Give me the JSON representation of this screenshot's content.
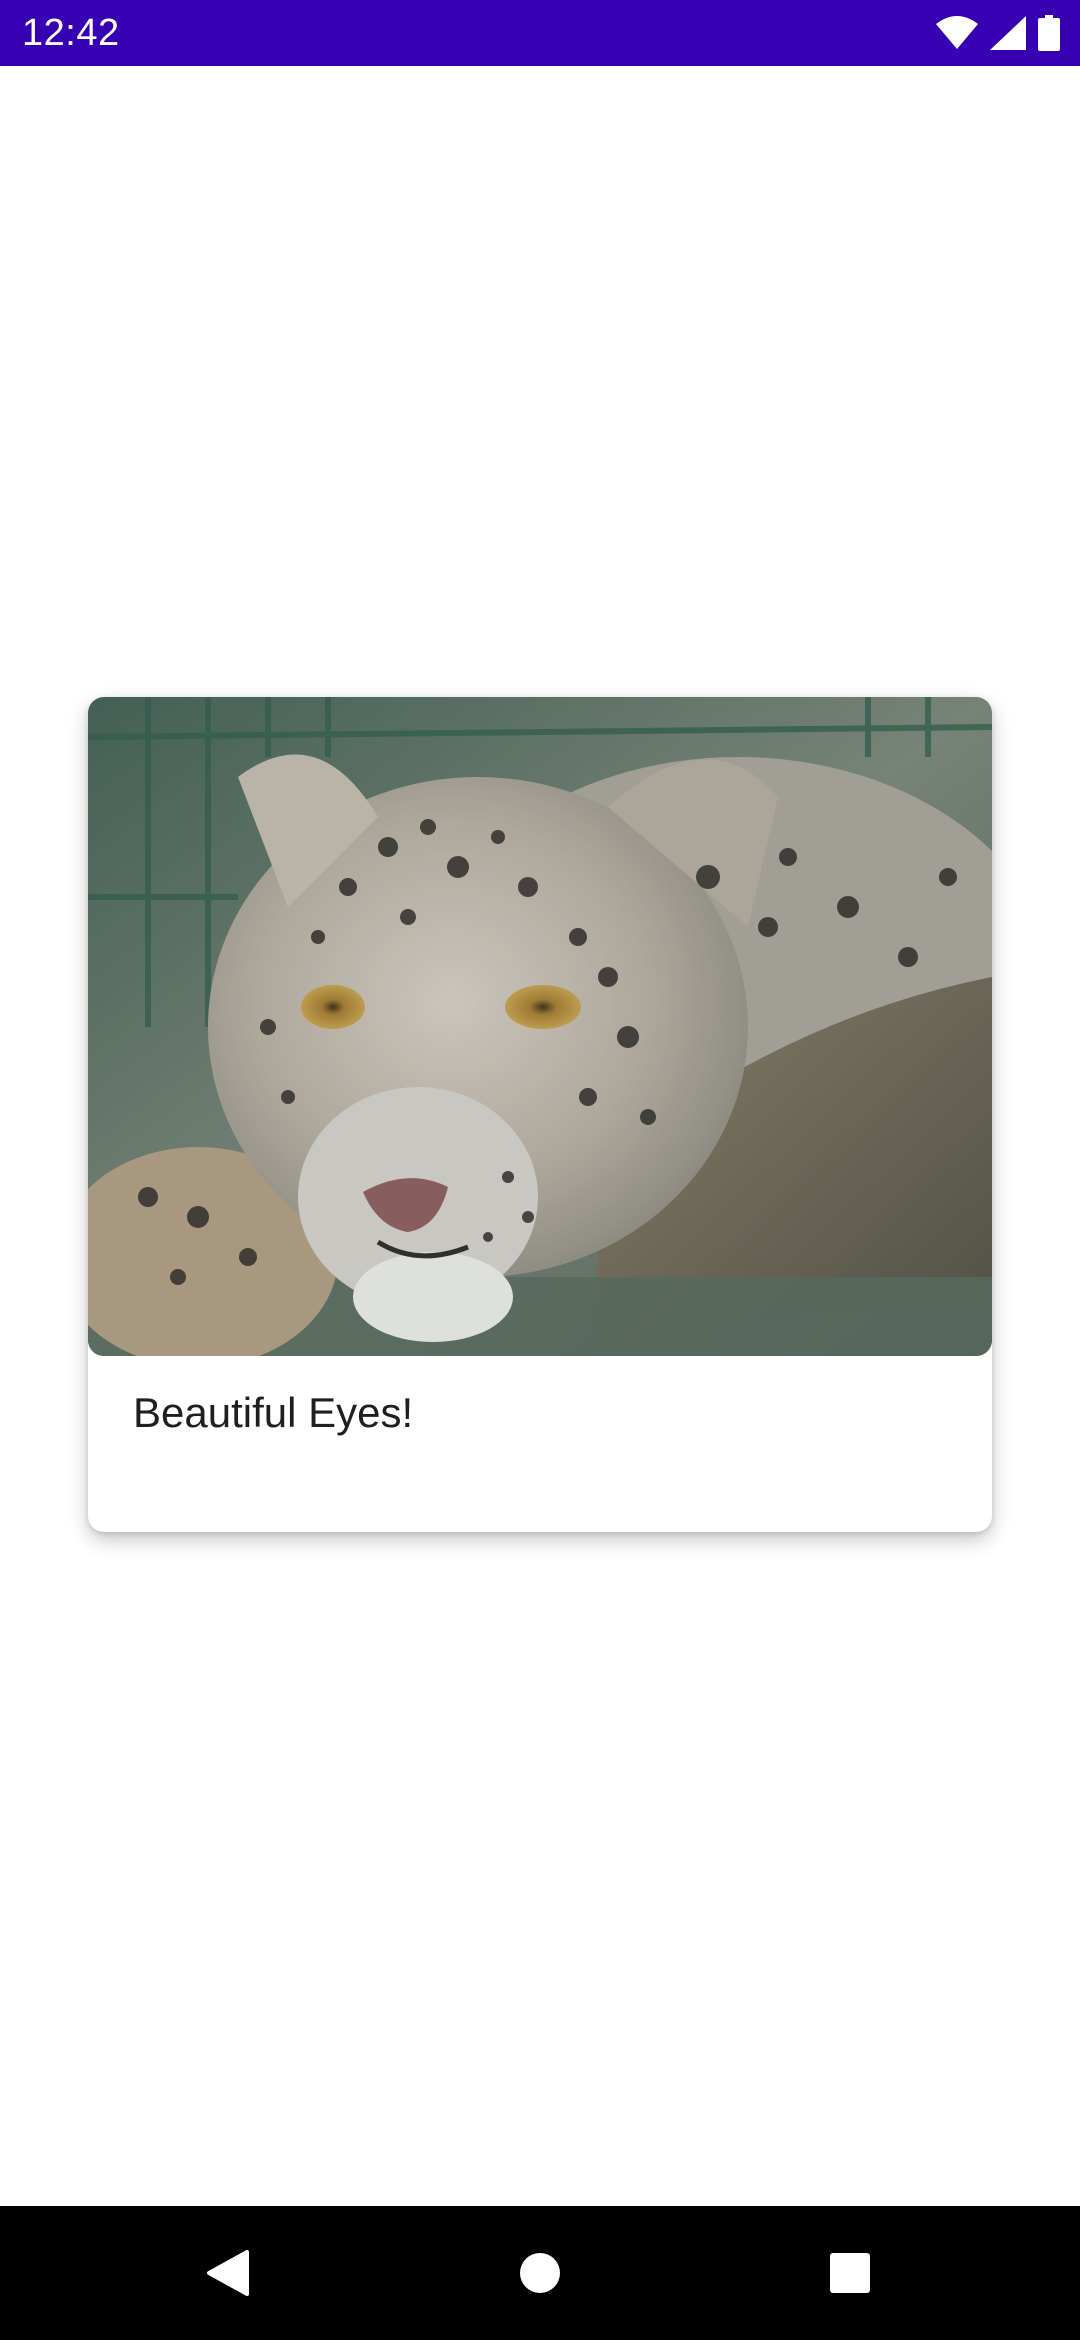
{
  "status_bar": {
    "time": "12:42",
    "icons": [
      "wifi-icon",
      "signal-icon",
      "battery-icon"
    ],
    "background": "#3700b3"
  },
  "card": {
    "image_alt": "snow-leopard-photo",
    "caption": "Beautiful Eyes!"
  },
  "nav_bar": {
    "buttons": [
      "back-icon",
      "home-icon",
      "recents-icon"
    ]
  }
}
